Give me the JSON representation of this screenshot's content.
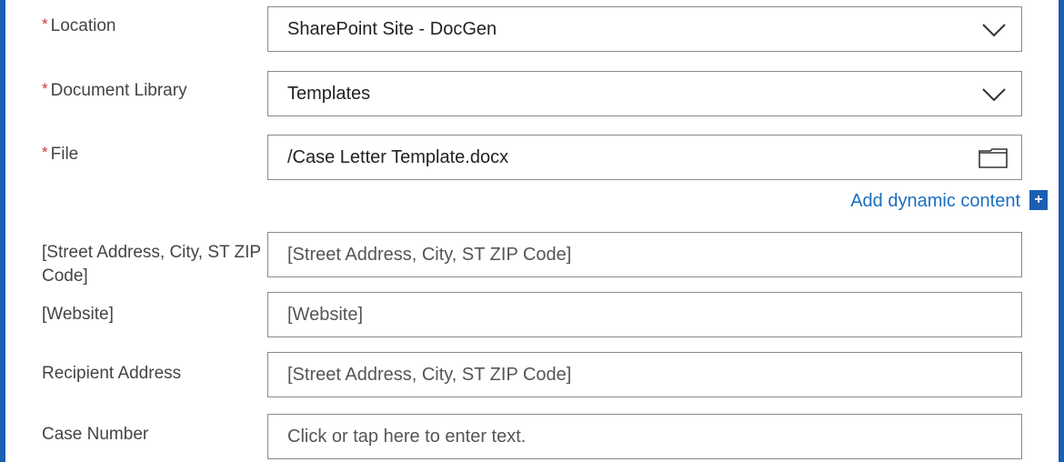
{
  "form": {
    "location": {
      "label": "Location",
      "required_mark": "*",
      "value": "SharePoint Site - DocGen"
    },
    "library": {
      "label": "Document Library",
      "required_mark": "*",
      "value": "Templates"
    },
    "file": {
      "label": "File",
      "required_mark": "*",
      "value": "/Case Letter Template.docx"
    },
    "dynamic_content_link": "Add dynamic content",
    "dynamic_content_icon": "+",
    "street_address": {
      "label": "[Street Address, City, ST ZIP Code]",
      "placeholder": "[Street Address, City, ST ZIP Code]"
    },
    "website": {
      "label": "[Website]",
      "placeholder": "[Website]"
    },
    "recipient_address": {
      "label": "Recipient Address",
      "placeholder": "[Street Address, City, ST ZIP Code]"
    },
    "case_number": {
      "label": "Case Number",
      "placeholder": "Click or tap here to enter text."
    }
  },
  "colors": {
    "accent": "#1b5fb0",
    "link": "#1b6ec2",
    "required": "#d13438"
  },
  "icons": {
    "dropdown": "chevron-down-icon",
    "file_picker": "folder-icon",
    "add": "plus-icon"
  }
}
